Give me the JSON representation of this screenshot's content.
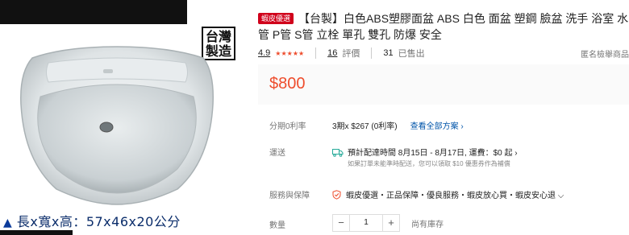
{
  "image_panel": {
    "stamp_line1": "台灣",
    "stamp_line2": "製造",
    "dimensions_marker": "▲",
    "dimensions_text": "長x寬x高：57x46x20公分"
  },
  "product": {
    "badge": "蝦皮優選",
    "title": "【台製】白色ABS塑膠面盆 ABS 白色 面盆 塑鋼 臉盆 洗手 浴室 水管 P管 S管 立栓 單孔 雙孔 防爆 安全"
  },
  "stats": {
    "rating": "4.9",
    "stars": "★★★★★",
    "reviews_count": "16",
    "reviews_label": "評價",
    "sold_count": "31",
    "sold_label": "已售出",
    "report_link": "匿名檢舉商品"
  },
  "price": "$800",
  "installment": {
    "label": "分期0利率",
    "value": "3期x $267 (0利率)",
    "link": "查看全部方案 ›"
  },
  "shipping": {
    "label": "運送",
    "value": "預計配達時間 8月15日 - 8月17日, 運費：$0 起  ›",
    "note": "如果訂單未能準時配送，您可以領取 $10 優惠券作為補償"
  },
  "services": {
    "label": "服務與保障",
    "value": "蝦皮優選・正品保障・優良服務・蝦皮放心買・蝦皮安心退  ⌵"
  },
  "quantity": {
    "label": "數量",
    "minus": "−",
    "value": "1",
    "plus": "+",
    "stock_text": "尚有庫存"
  },
  "colors": {
    "accent": "#ee4d2d",
    "badge": "#d0011b",
    "link": "#0055aa"
  }
}
